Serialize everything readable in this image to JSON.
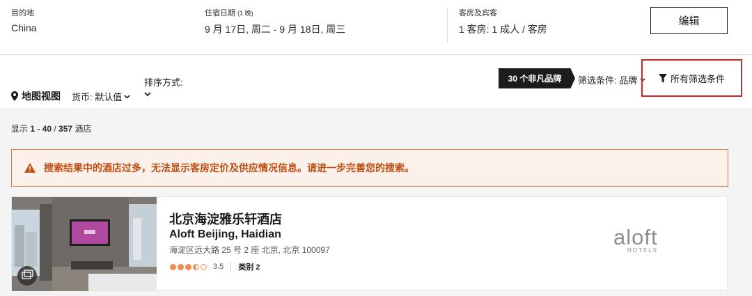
{
  "search": {
    "destination_label": "目的地",
    "destination_value": "China",
    "dates_label": "住宿日期",
    "nights": "(1 晚)",
    "dates_value": "9 月 17日, 周二 - 9 月 18日, 周三",
    "rooms_label": "客房及宾客",
    "rooms_value": "1 客房: 1 成人 / 客房",
    "edit_label": "编辑"
  },
  "toolbar": {
    "map_view": "地图视图",
    "currency": "货币: 默认值",
    "sort_label": "排序方式:",
    "brand_badge": "30 个非凡品牌",
    "filter_brand": "筛选条件: 品牌",
    "all_filters": "所有筛选条件"
  },
  "results": {
    "prefix": "显示 ",
    "range": "1 - 40",
    "sep": " / ",
    "total": "357",
    "suffix": " 酒店"
  },
  "warning": {
    "text": "搜索结果中的酒店过多，无法显示客房定价及供应情况信息。请进一步完善您的搜索。",
    "color": "#c04e10"
  },
  "hotel": {
    "name_zh": "北京海淀雅乐轩酒店",
    "name_en": "Aloft Beijing, Haidian",
    "address": "海淀区远大路 25 号 2 座 北京, 北京 100097",
    "rating": 3.5,
    "rating_text": "3.5",
    "category": "类别 2",
    "logo_text": "aloft",
    "logo_sub": "HOTELS",
    "rating_color": "#f08c50"
  },
  "colors": {
    "highlight_box": "#e02020",
    "badge_bg": "#1c1c1c"
  }
}
